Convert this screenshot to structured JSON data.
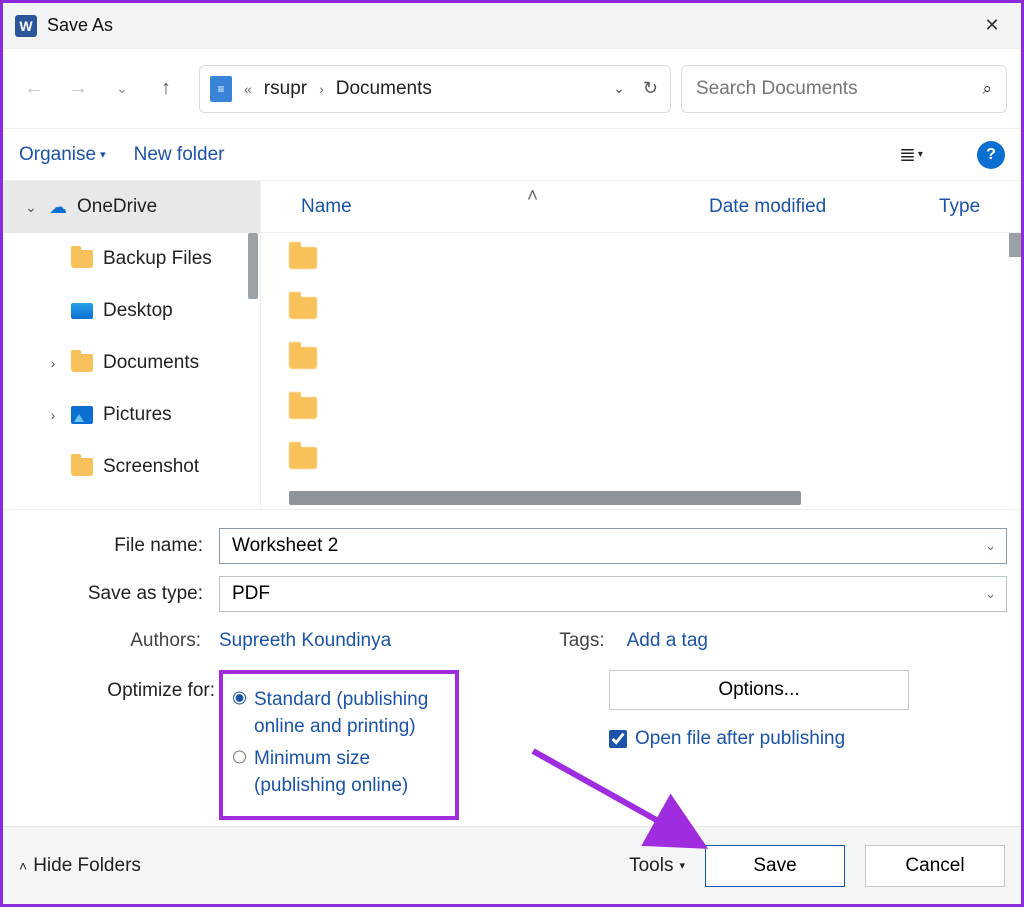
{
  "title": "Save As",
  "breadcrumb": {
    "user": "rsupr",
    "folder": "Documents"
  },
  "search": {
    "placeholder": "Search Documents"
  },
  "toolbar": {
    "organise": "Organise",
    "new_folder": "New folder",
    "help_glyph": "?"
  },
  "tree": {
    "items": [
      {
        "label": "OneDrive",
        "icon": "cloud",
        "expanded": true,
        "selected": true
      },
      {
        "label": "Backup Files",
        "icon": "folder",
        "child": true
      },
      {
        "label": "Desktop",
        "icon": "desktop",
        "child": true
      },
      {
        "label": "Documents",
        "icon": "folder",
        "child": true,
        "expandable": true
      },
      {
        "label": "Pictures",
        "icon": "picture",
        "child": true,
        "expandable": true
      },
      {
        "label": "Screenshot",
        "icon": "folder",
        "child": true
      }
    ]
  },
  "columns": {
    "name": "Name",
    "date": "Date modified",
    "type": "Type"
  },
  "form": {
    "file_name_label": "File name:",
    "file_name_value": "Worksheet 2",
    "save_type_label": "Save as type:",
    "save_type_value": "PDF",
    "authors_label": "Authors:",
    "authors_value": "Supreeth Koundinya",
    "tags_label": "Tags:",
    "tags_value": "Add a tag",
    "optimize_label": "Optimize for:",
    "opt_standard": "Standard (publishing online and printing)",
    "opt_minimum": "Minimum size (publishing online)",
    "options_btn": "Options...",
    "open_after": "Open file after publishing"
  },
  "footer": {
    "hide": "Hide Folders",
    "tools": "Tools",
    "save": "Save",
    "cancel": "Cancel"
  },
  "blurred_rows": [
    {
      "name_w": 130,
      "date_w": 170,
      "type_w": 44
    },
    {
      "name_w": 120,
      "date_w": 170,
      "type_w": 44
    },
    {
      "name_w": 150,
      "date_w": 160,
      "type_w": 44
    },
    {
      "name_w": 240,
      "date_w": 170,
      "type_w": 44
    },
    {
      "name_w": 70,
      "date_w": 170,
      "type_w": 44
    }
  ]
}
